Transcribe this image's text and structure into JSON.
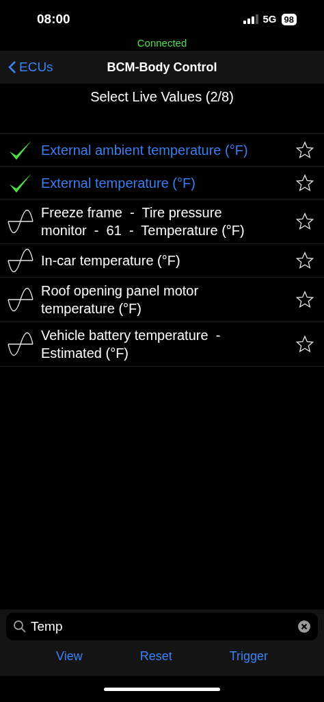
{
  "status_bar": {
    "time": "08:00",
    "network": "5G",
    "battery": "98"
  },
  "connection": {
    "text": "Connected"
  },
  "nav": {
    "back": "ECUs",
    "title": "BCM-Body Control"
  },
  "subtitle": "Select Live Values (2/8)",
  "items": [
    {
      "label": "External ambient temperature (°F)",
      "selected": true,
      "starred": false
    },
    {
      "label": "External temperature (°F)",
      "selected": true,
      "starred": false
    },
    {
      "label": "Freeze frame  -  Tire pressure monitor  -  61  -  Temperature (°F)",
      "selected": false,
      "starred": false
    },
    {
      "label": "In-car temperature (°F)",
      "selected": false,
      "starred": false
    },
    {
      "label": "Roof opening panel motor temperature (°F)",
      "selected": false,
      "starred": false
    },
    {
      "label": "Vehicle battery temperature  -  Estimated (°F)",
      "selected": false,
      "starred": false
    }
  ],
  "search": {
    "value": "Temp"
  },
  "toolbar": [
    "View",
    "Reset",
    "Trigger"
  ]
}
